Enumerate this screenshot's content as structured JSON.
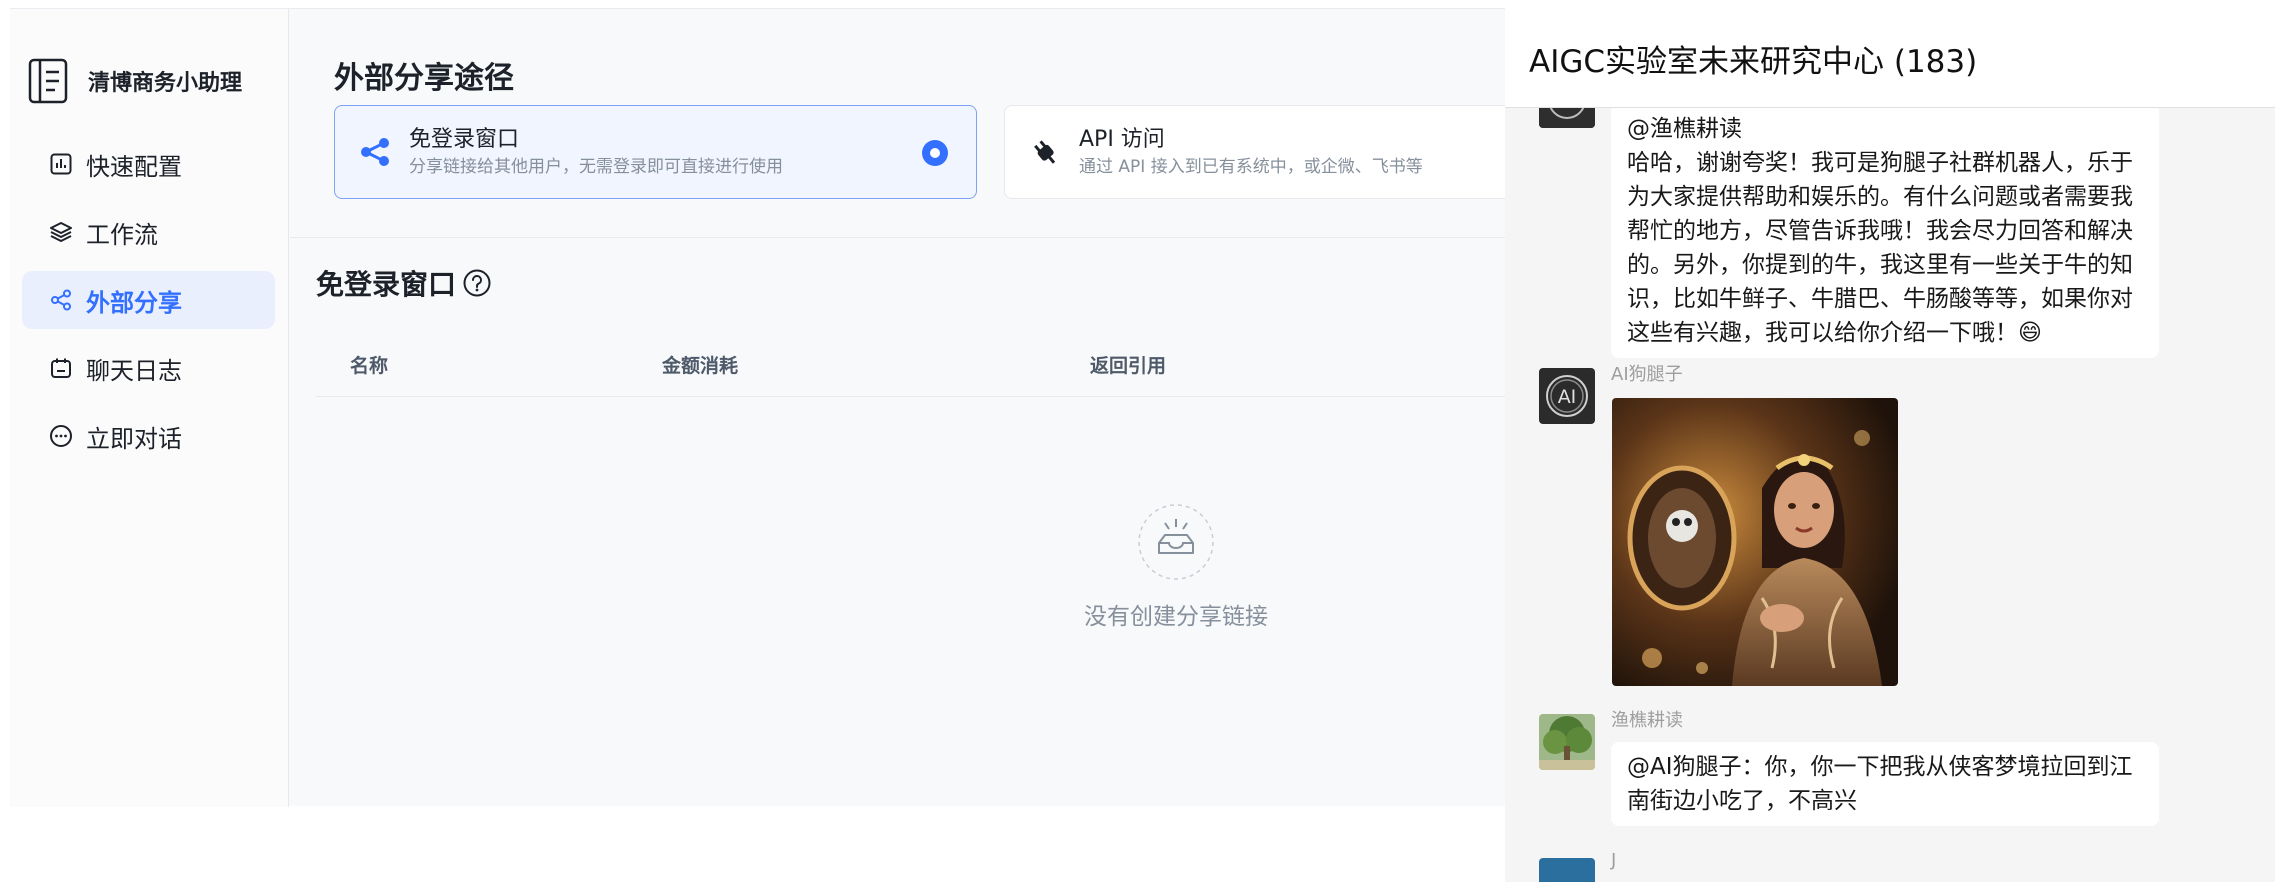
{
  "app": {
    "name": "清博商务小助理",
    "nav": [
      {
        "label": "快速配置",
        "icon": "chart-bar-icon"
      },
      {
        "label": "工作流",
        "icon": "layers-icon"
      },
      {
        "label": "外部分享",
        "icon": "share-icon",
        "active": true
      },
      {
        "label": "聊天日志",
        "icon": "calendar-log-icon"
      },
      {
        "label": "立即对话",
        "icon": "chat-bubble-icon"
      }
    ]
  },
  "main": {
    "title": "外部分享途径",
    "share_options": [
      {
        "title": "免登录窗口",
        "desc": "分享链接给其他用户，无需登录即可直接进行使用",
        "selected": true
      },
      {
        "title": "API 访问",
        "desc": "通过 API 接入到已有系统中，或企微、飞书等",
        "selected": false
      }
    ],
    "section_title": "免登录窗口",
    "columns": [
      "名称",
      "金额消耗",
      "返回引用"
    ],
    "empty_text": "没有创建分享链接"
  },
  "chat": {
    "title": "AIGC实验室未来研究中心 (183)",
    "messages": [
      {
        "sender": "",
        "text": "@渔樵耕读\n哈哈，谢谢夸奖！我可是狗腿子社群机器人，乐于为大家提供帮助和娱乐的。有什么问题或者需要我帮忙的地方，尽管告诉我哦！我会尽力回答和解决的。另外，你提到的牛，我这里有一些关于牛的知识，比如牛鲜子、牛腊巴、牛肠酸等等，如果你对这些有兴趣，我可以给你介绍一下哦！😄"
      },
      {
        "sender": "AI狗腿子",
        "image": "woman-portrait-image"
      },
      {
        "sender": "渔樵耕读",
        "text": "@AI狗腿子：你，你一下把我从侠客梦境拉回到江南街边小吃了，不高兴"
      },
      {
        "sender": "J",
        "text": ""
      }
    ]
  },
  "colors": {
    "accent": "#3370ff",
    "active_bg": "#e9effd",
    "chat_bg": "#f5f5f5"
  }
}
